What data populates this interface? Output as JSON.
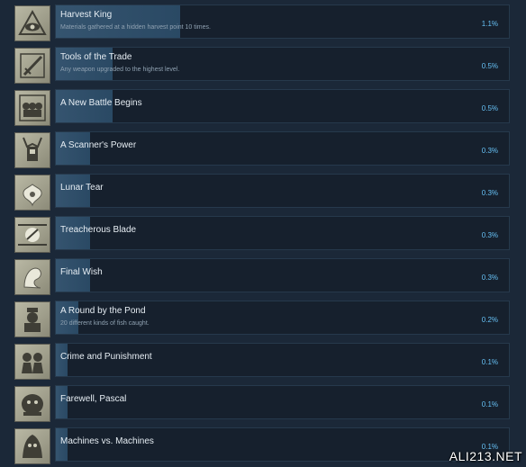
{
  "achievements": [
    {
      "title": "Harvest King",
      "desc": "Materials gathered at a hidden harvest point 10 times.",
      "pct": "1.1%",
      "fill": 0.011,
      "icon": "eye-icon"
    },
    {
      "title": "Tools of the Trade",
      "desc": "Any weapon upgraded to the highest level.",
      "pct": "0.5%",
      "fill": 0.005,
      "icon": "sword-icon"
    },
    {
      "title": "A New Battle Begins",
      "desc": "",
      "pct": "0.5%",
      "fill": 0.005,
      "icon": "machines-icon"
    },
    {
      "title": "A Scanner's Power",
      "desc": "",
      "pct": "0.3%",
      "fill": 0.003,
      "icon": "scanner-icon"
    },
    {
      "title": "Lunar Tear",
      "desc": "",
      "pct": "0.3%",
      "fill": 0.003,
      "icon": "flower-icon"
    },
    {
      "title": "Treacherous Blade",
      "desc": "",
      "pct": "0.3%",
      "fill": 0.003,
      "icon": "blade-icon"
    },
    {
      "title": "Final Wish",
      "desc": "",
      "pct": "0.3%",
      "fill": 0.003,
      "icon": "wish-icon"
    },
    {
      "title": "A Round by the Pond",
      "desc": "20 different kinds of fish caught.",
      "pct": "0.2%",
      "fill": 0.002,
      "icon": "fisher-icon"
    },
    {
      "title": "Crime and Punishment",
      "desc": "",
      "pct": "0.1%",
      "fill": 0.001,
      "icon": "prisoners-icon"
    },
    {
      "title": "Farewell, Pascal",
      "desc": "",
      "pct": "0.1%",
      "fill": 0.001,
      "icon": "pascal-icon"
    },
    {
      "title": "Machines vs. Machines",
      "desc": "",
      "pct": "0.1%",
      "fill": 0.001,
      "icon": "hooded-machine-icon"
    }
  ],
  "watermark": "ALI213.NET"
}
